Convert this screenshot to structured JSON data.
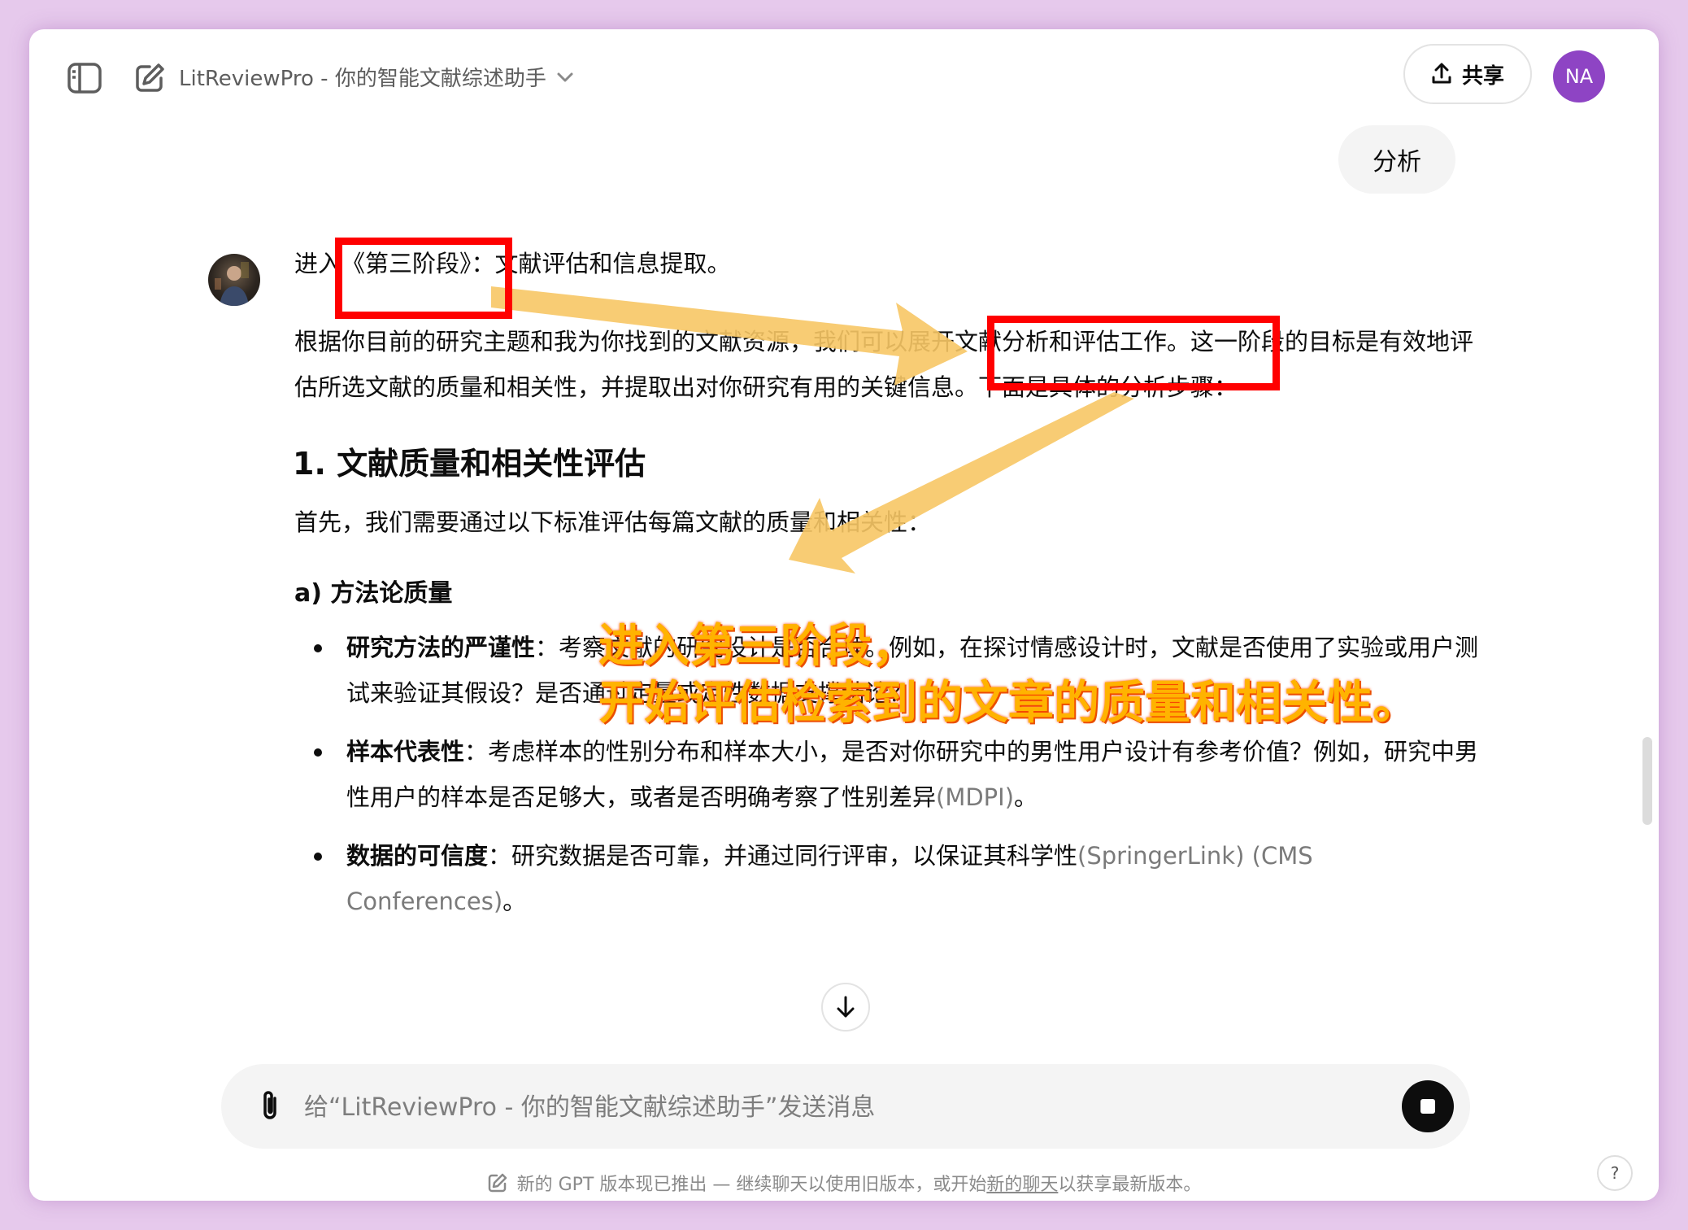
{
  "header": {
    "app_title": "LitReviewPro - 你的智能文献综述助手",
    "share_label": "共享",
    "user_initials": "NA"
  },
  "user_message": "分析",
  "assistant": {
    "intro": "进入《第三阶段》：文献评估和信息提取。",
    "para1": "根据你目前的研究主题和我为你找到的文献资源，我们可以展开文献分析和评估工作。这一阶段的目标是有效地评估所选文献的质量和相关性，并提取出对你研究有用的关键信息。下面是具体的分析步骤：",
    "section1_title": "1. 文献质量和相关性评估",
    "section1_intro": "首先，我们需要通过以下标准评估每篇文献的质量和相关性：",
    "subsection_a": "a) 方法论质量",
    "bullets": [
      {
        "term": "研究方法的严谨性",
        "sep": "：",
        "text": "考察文献的研究设计是否合理。例如，在探讨情感设计时，文献是否使用了实验或用户测试来验证其假设？是否通过定量或定性数据支撑结论？",
        "cite": ""
      },
      {
        "term": "样本代表性",
        "sep": "：",
        "text": "考虑样本的性别分布和样本大小，是否对你研究中的男性用户设计有参考价值？例如，研究中男性用户的样本是否足够大，或者是否明确考察了性别差异",
        "cite": "(MDPI)",
        "tail": "。"
      },
      {
        "term": "数据的可信度",
        "sep": "：",
        "text": "研究数据是否可靠，并通过同行评审，以保证其科学性",
        "cite": "(SpringerLink) (CMS Conferences)",
        "tail": "。"
      }
    ]
  },
  "composer": {
    "placeholder": "给“LitReviewPro - 你的智能文献综述助手”发送消息"
  },
  "footer": {
    "notice_prefix": "新的 GPT 版本现已推出 — 继续聊天以使用旧版本，或开始",
    "notice_link": "新的聊天",
    "notice_suffix": "以获享最新版本。",
    "help": "?"
  },
  "annotation": {
    "caption_line1": "进入第三阶段，",
    "caption_line2": "开始评估检索到的文章的质量和相关性。",
    "highlight_color": "#ff0000",
    "arrow_color": "#f7c765",
    "caption_color": "#ffb300"
  },
  "colors": {
    "background": "#e6c9ec",
    "avatar": "#8e44c4",
    "text": "#0d0d0d"
  }
}
